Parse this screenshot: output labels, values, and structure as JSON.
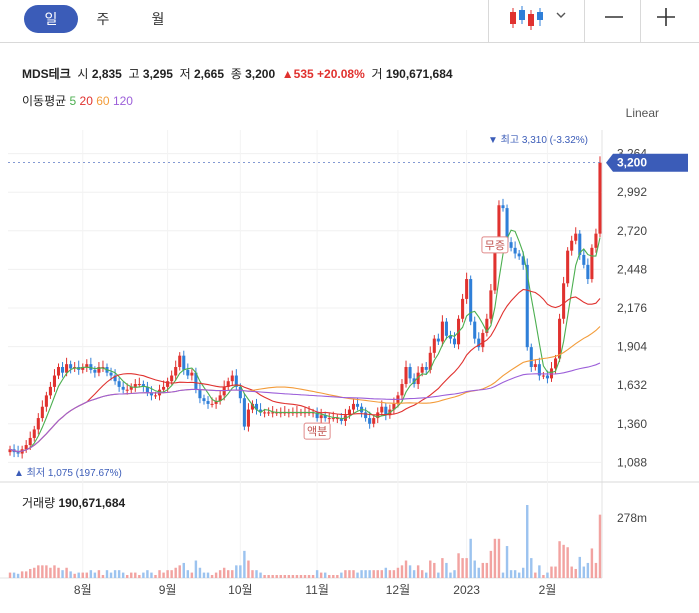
{
  "tabs": [
    "일",
    "주",
    "월"
  ],
  "ticker": {
    "name": "MDS테크",
    "open_label": "시",
    "open": "2,835",
    "high_label": "고",
    "high": "3,295",
    "low_label": "저",
    "low": "2,665",
    "close_label": "종",
    "close": "3,200",
    "change": "▲535",
    "change_pct": "+20.08%",
    "volume_label": "거",
    "volume": "190,671,684"
  },
  "moving_average": {
    "label": "이동평균",
    "periods": [
      {
        "value": "5",
        "color": "#4caf50"
      },
      {
        "value": "20",
        "color": "#e0322f"
      },
      {
        "value": "60",
        "color": "#f39c3a"
      },
      {
        "value": "120",
        "color": "#9c5fd9"
      }
    ]
  },
  "scale_mode": "Linear",
  "colors": {
    "up": "#e0322f",
    "down": "#2f7fd8",
    "accent": "#3b5cb8"
  },
  "chart_data": {
    "type": "candlestick",
    "y_ticks": [
      "3,264",
      "2,992",
      "2,720",
      "2,448",
      "2,176",
      "1,904",
      "1,632",
      "1,360",
      "1,088"
    ],
    "y_tick_values": [
      3264,
      2992,
      2720,
      2448,
      2176,
      1904,
      1632,
      1360,
      1088
    ],
    "ylim": [
      1020,
      3360
    ],
    "x_ticks": [
      "8월",
      "9월",
      "10월",
      "11월",
      "12월",
      "2023",
      "2월"
    ],
    "x_tick_index": [
      18,
      39,
      57,
      76,
      96,
      113,
      133
    ],
    "current_price_label": "3,200",
    "max_annotation": "▼ 최고 3,310 (-3.32%)",
    "min_annotation": "▲ 최저 1,075 (197.67%)",
    "events": [
      {
        "label": "액분",
        "index": 76
      },
      {
        "label": "무증",
        "index": 120
      }
    ],
    "closes": [
      1180,
      1160,
      1150,
      1180,
      1210,
      1260,
      1320,
      1400,
      1480,
      1560,
      1620,
      1700,
      1760,
      1720,
      1780,
      1750,
      1760,
      1740,
      1760,
      1780,
      1740,
      1720,
      1760,
      1760,
      1720,
      1700,
      1660,
      1620,
      1600,
      1600,
      1620,
      1640,
      1640,
      1620,
      1580,
      1560,
      1560,
      1600,
      1620,
      1660,
      1700,
      1760,
      1840,
      1740,
      1700,
      1720,
      1600,
      1540,
      1520,
      1500,
      1500,
      1520,
      1560,
      1620,
      1660,
      1700,
      1620,
      1540,
      1340,
      1460,
      1500,
      1460,
      1440,
      1440,
      1440,
      1440,
      1440,
      1440,
      1440,
      1440,
      1440,
      1440,
      1440,
      1440,
      1440,
      1440,
      1400,
      1420,
      1400,
      1400,
      1400,
      1400,
      1380,
      1420,
      1460,
      1500,
      1480,
      1440,
      1400,
      1360,
      1400,
      1440,
      1480,
      1420,
      1460,
      1500,
      1560,
      1640,
      1760,
      1680,
      1640,
      1720,
      1760,
      1740,
      1860,
      1960,
      1940,
      2080,
      1980,
      1960,
      1920,
      2100,
      2240,
      2380,
      2080,
      1960,
      1900,
      2000,
      2100,
      2300,
      2600,
      2900,
      2880,
      2640,
      2600,
      2560,
      2540,
      2480,
      1900,
      1760,
      1780,
      1700,
      1700,
      1680,
      1750,
      1820,
      2100,
      2350,
      2580,
      2650,
      2700,
      2550,
      2480,
      2380,
      2600,
      2700,
      3200
    ],
    "volume": {
      "label": "거래량",
      "value": "190,671,684",
      "axis_label": "278m"
    }
  }
}
